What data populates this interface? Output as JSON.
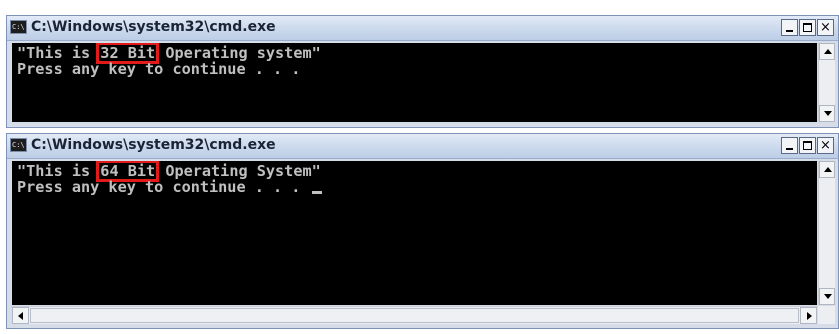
{
  "windows": [
    {
      "title": "C:\\Windows\\system32\\cmd.exe",
      "icon": "cmd-icon",
      "icon_text": "C:\\",
      "caption_buttons": [
        "minimize",
        "maximize",
        "close"
      ],
      "close_label": "×",
      "lines": [
        {
          "pre": "\"This is ",
          "highlight": "32 Bit",
          "post": " Operating system\""
        },
        {
          "text": "Press any key to continue . . ."
        }
      ],
      "cursor": false
    },
    {
      "title": "C:\\Windows\\system32\\cmd.exe",
      "icon": "cmd-icon",
      "icon_text": "C:\\",
      "caption_buttons": [
        "minimize",
        "maximize",
        "close"
      ],
      "close_label": "×",
      "lines": [
        {
          "pre": "\"This is ",
          "highlight": "64 Bit",
          "post": " Operating System\""
        },
        {
          "text": "Press any key to continue . . . "
        }
      ],
      "cursor": true
    }
  ],
  "colors": {
    "console_bg": "#000000",
    "console_text": "#c0c0c0",
    "highlight_box": "#e21a1a",
    "titlebar": "#cfdcee"
  }
}
